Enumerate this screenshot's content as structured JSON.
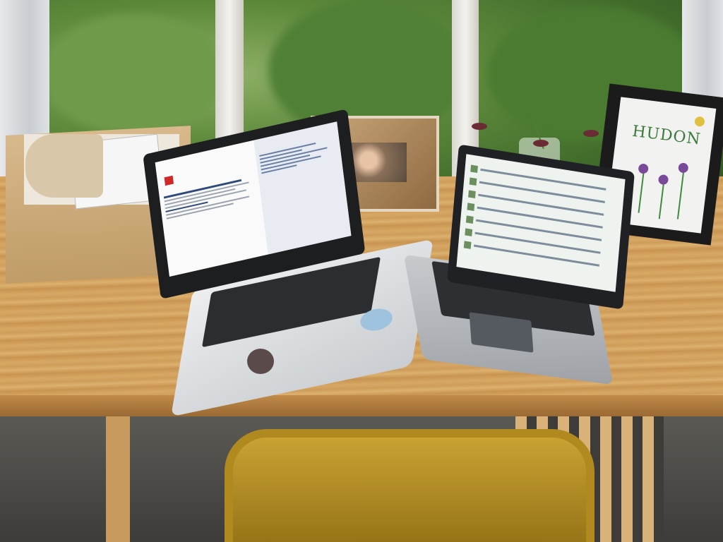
{
  "scene": {
    "drawing_text": "HUDON",
    "colors": {
      "table_wood": "#d7a866",
      "foliage": "#5e8a3c",
      "chair": "#c9a233",
      "laptop_bezel": "#1d1e20"
    }
  },
  "icons": [
    "github-octocat-sticker-icon",
    "chrome-sticker-icon",
    "red-cross-logo-icon"
  ]
}
